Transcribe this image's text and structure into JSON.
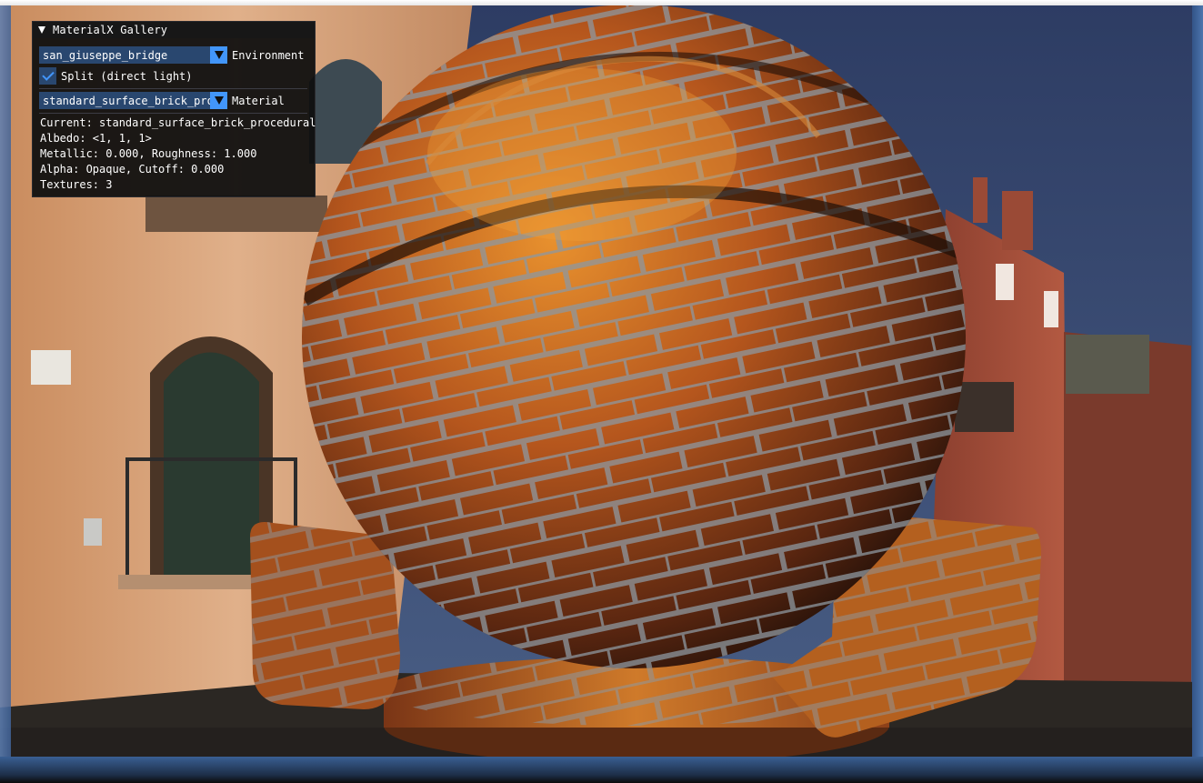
{
  "panel": {
    "title": "MaterialX Gallery",
    "environment": {
      "selected": "san_giuseppe_bridge",
      "label": "Environment"
    },
    "split_checkbox": {
      "label": "Split (direct light)",
      "checked": true
    },
    "material": {
      "selected": "standard_surface_brick_procedural",
      "label": "Material"
    },
    "info": {
      "current": "Current: standard_surface_brick_procedural",
      "albedo": "Albedo: <1, 1, 1>",
      "metallic_roughness": "Metallic: 0.000, Roughness: 1.000",
      "alpha": "Alpha: Opaque, Cutoff: 0.000",
      "textures": "Textures: 3"
    }
  },
  "viewport": {
    "subject": "shaderball",
    "colors": {
      "brick": "#c0651f",
      "mortar": "#8a949c",
      "sky": "#3c4f77",
      "facade": "#d9a476",
      "accent": "#4296fa"
    }
  }
}
